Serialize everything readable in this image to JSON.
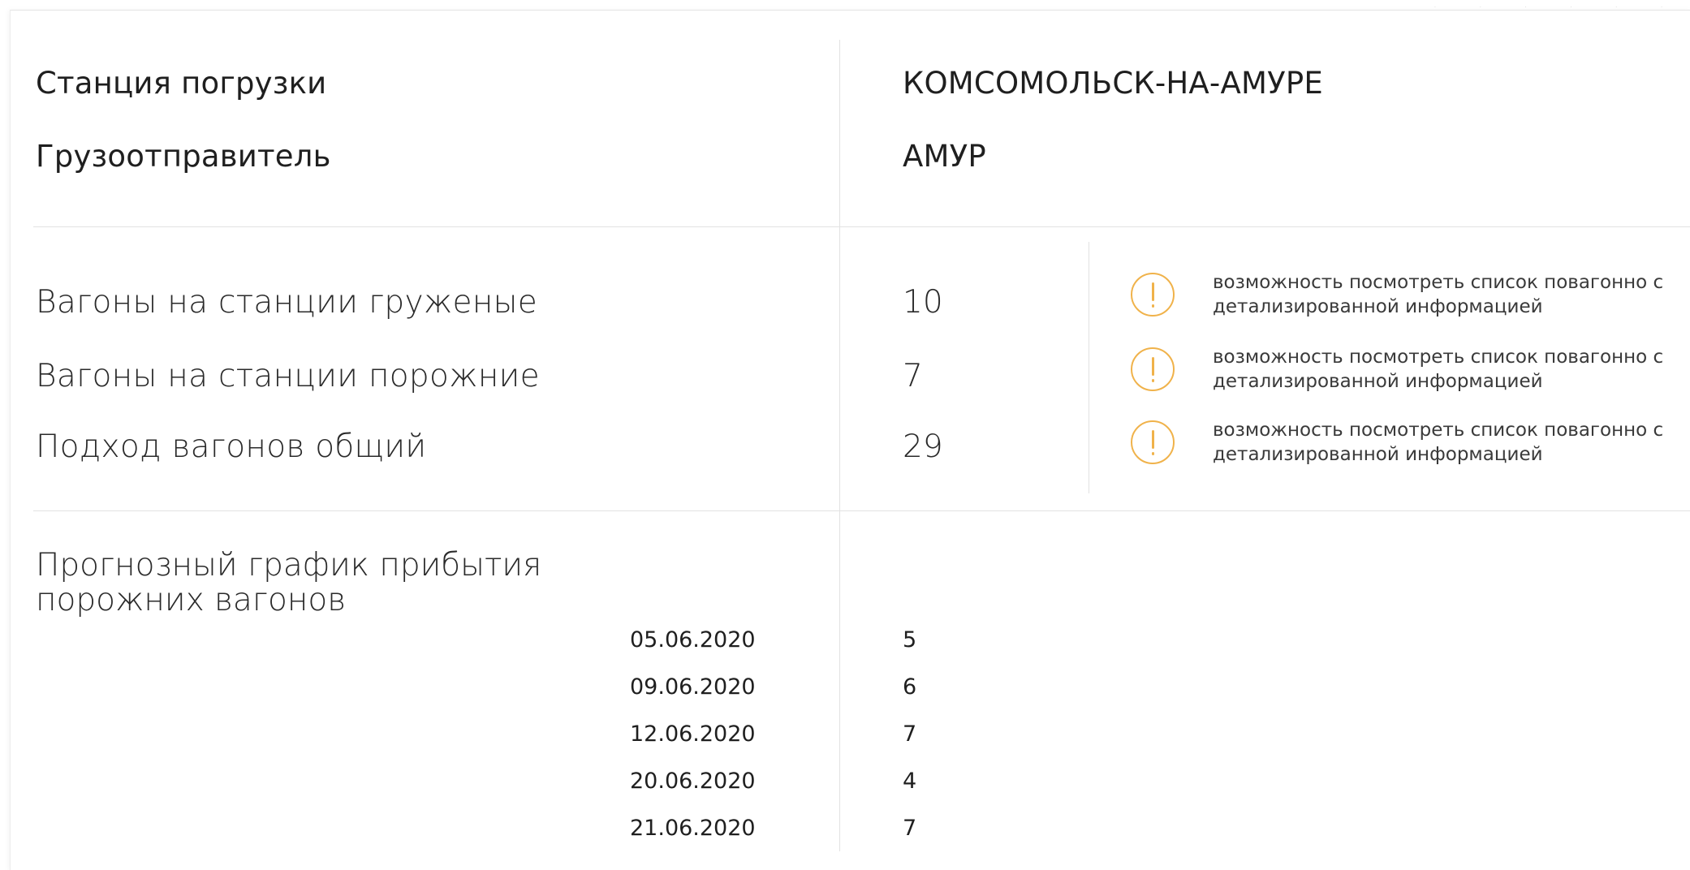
{
  "station_info": {
    "loading_station_label": "Станция погрузки",
    "loading_station_value": "КОМСОМОЛЬСК-НА-АМУРЕ",
    "shipper_label": "Грузоотправитель",
    "shipper_value": "АМУР"
  },
  "wagons": [
    {
      "label": "Вагоны на станции груженые",
      "value": "10",
      "hint": "возможность посмотреть список повагонно с детализированной информацией",
      "icon": "exclamation-circle-icon"
    },
    {
      "label": "Вагоны на станции порожние",
      "value": "7",
      "hint": "возможность посмотреть список повагонно с детализированной информацией",
      "icon": "exclamation-circle-icon"
    },
    {
      "label": "Подход вагонов общий",
      "value": "29",
      "hint": "возможность посмотреть список повагонно с детализированной информацией",
      "icon": "exclamation-circle-icon"
    }
  ],
  "forecast": {
    "title": "Прогнозный график прибытия порожних вагонов",
    "rows": [
      {
        "date": "05.06.2020",
        "count": "5"
      },
      {
        "date": "09.06.2020",
        "count": "6"
      },
      {
        "date": "12.06.2020",
        "count": "7"
      },
      {
        "date": "20.06.2020",
        "count": "4"
      },
      {
        "date": "21.06.2020",
        "count": "7"
      }
    ]
  },
  "colors": {
    "accent_warning": "#f0b24a",
    "divider": "#e2e2e2",
    "text": "#1f1f1f"
  }
}
